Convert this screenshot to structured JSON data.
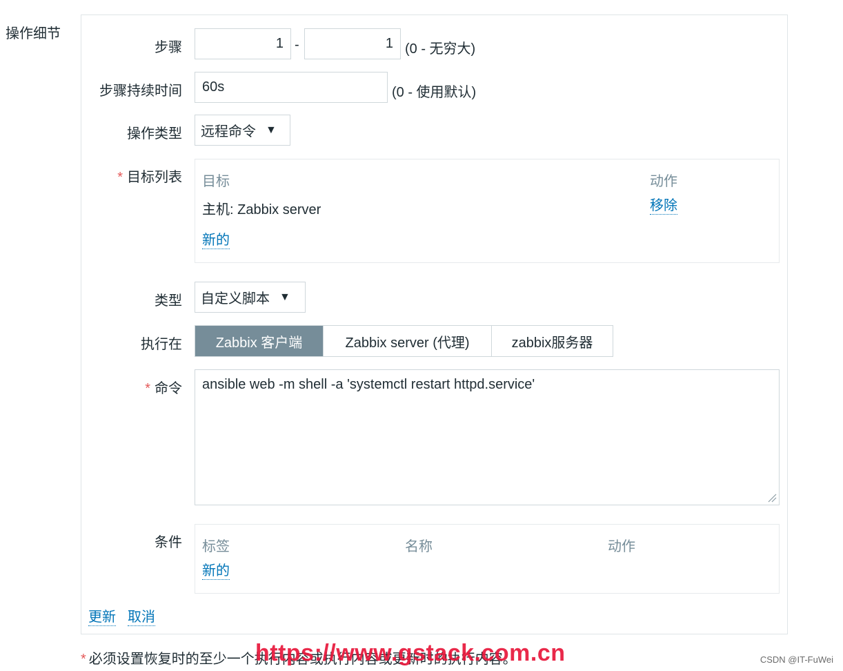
{
  "section_label": "操作细节",
  "steps": {
    "label": "步骤",
    "from": "1",
    "separator": "-",
    "to": "1",
    "hint": "(0 - 无穷大)"
  },
  "step_duration": {
    "label": "步骤持续时间",
    "value": "60s",
    "hint": "(0 - 使用默认)"
  },
  "operation_type": {
    "label": "操作类型",
    "value": "远程命令",
    "arrow": "▼"
  },
  "target_list": {
    "required_mark": "*",
    "label": "目标列表",
    "col_target": "目标",
    "col_action": "动作",
    "rows": [
      {
        "target": "主机: Zabbix server",
        "action": "移除"
      }
    ],
    "new_link": "新的"
  },
  "type": {
    "label": "类型",
    "value": "自定义脚本",
    "arrow": "▼"
  },
  "execute_on": {
    "label": "执行在",
    "options": [
      "Zabbix 客户端",
      "Zabbix server (代理)",
      "zabbix服务器"
    ],
    "selected": "Zabbix 客户端"
  },
  "command": {
    "required_mark": "*",
    "label": "命令",
    "value": "ansible web -m shell -a 'systemctl restart httpd.service'"
  },
  "conditions": {
    "label": "条件",
    "col_label": "标签",
    "col_name": "名称",
    "col_action": "动作",
    "new_link": "新的"
  },
  "form_actions": {
    "update": "更新",
    "cancel": "取消"
  },
  "footnote": {
    "mark": "*",
    "text": "必须设置恢复时的至少一个执行内容或执行内容或更新时的执行内容。"
  },
  "watermark": "https://www.gstack.com.cn",
  "credit": "CSDN @IT-FuWei",
  "colors": {
    "link": "#0275b8",
    "active_segment": "#768d99",
    "required": "#e45959",
    "watermark": "#e8173b"
  }
}
